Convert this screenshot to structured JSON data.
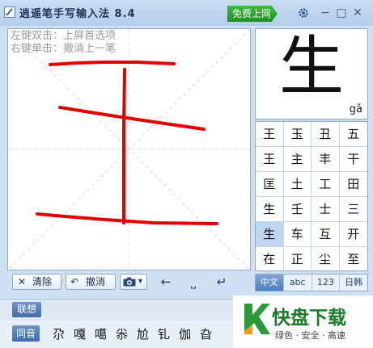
{
  "window": {
    "title": "逍遥笔手写输入法 8.4",
    "free_online_label": "免费上网",
    "controls": {
      "settings": "gear-icon",
      "minimize": "−",
      "maximize": "□",
      "close": "✕"
    }
  },
  "pad": {
    "hint_line1": "左键双击：上屏首选项",
    "hint_line2": "右键单击：撤消上一笔",
    "stroke_color": "#e00000"
  },
  "toolbar": {
    "clear_label": "清除",
    "undo_label": "撤消",
    "camera_label": "▾",
    "left_arrow": "←",
    "space": "⎵",
    "enter": "↵"
  },
  "preview": {
    "char": "生",
    "pinyin": "gǎ"
  },
  "candidates": [
    "王",
    "玉",
    "丑",
    "五",
    "王",
    "主",
    "丰",
    "干",
    "匡",
    "土",
    "工",
    "田",
    "生",
    "壬",
    "士",
    "三",
    "生",
    "车",
    "互",
    "开",
    "在",
    "正",
    "尘",
    "至"
  ],
  "selected_index": 16,
  "modes": [
    {
      "label": "中文",
      "active": true
    },
    {
      "label": "abc",
      "active": false
    },
    {
      "label": "123",
      "active": false
    },
    {
      "label": "日韩",
      "active": false
    }
  ],
  "assoc_label": "联想",
  "homophone_label": "同音",
  "homophones": [
    "尕",
    "嘎",
    "噶",
    "尜",
    "尬",
    "钆",
    "伽",
    "旮"
  ],
  "watermark": {
    "mark": "K",
    "title": "快盘下载",
    "sub": "绿色 · 安全 · 高速"
  },
  "colors": {
    "accent": "#4d7fbf",
    "free_btn": "#2aa32d",
    "stroke": "#e00000"
  }
}
